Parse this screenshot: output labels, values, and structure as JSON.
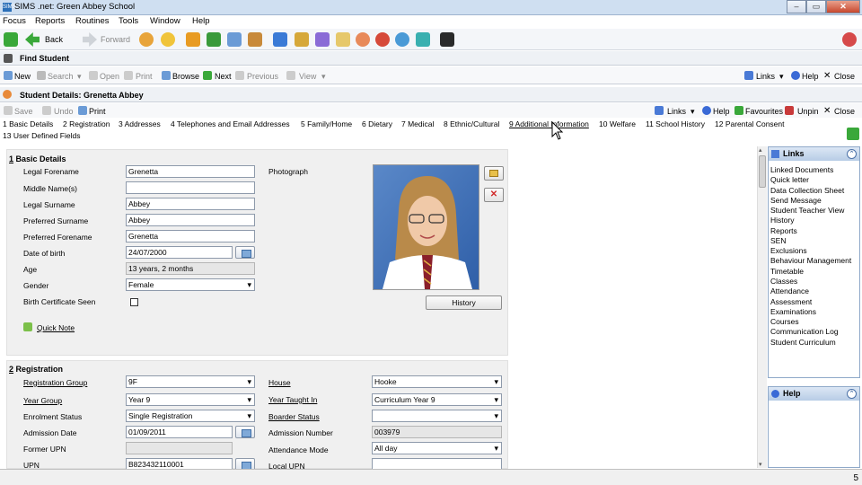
{
  "window": {
    "title": "SIMS .net: Green Abbey School",
    "logo_text": "SIMS"
  },
  "menu": [
    "Focus",
    "Reports",
    "Routines",
    "Tools",
    "Window",
    "Help"
  ],
  "nav": {
    "back": "Back",
    "forward": "Forward"
  },
  "find_student": {
    "title": "Find Student",
    "toolbar": {
      "new": "New",
      "search": "Search",
      "open": "Open",
      "print": "Print",
      "browse": "Browse",
      "next": "Next",
      "previous": "Previous",
      "view": "View",
      "links": "Links",
      "help": "Help",
      "close": "Close"
    }
  },
  "student_details": {
    "title": "Student Details: Grenetta Abbey",
    "toolbar": {
      "save": "Save",
      "undo": "Undo",
      "print": "Print",
      "links": "Links",
      "help": "Help",
      "favourites": "Favourites",
      "unpin": "Unpin",
      "close": "Close"
    },
    "tabs": [
      "1 Basic Details",
      "2 Registration",
      "3 Addresses",
      "4 Telephones and Email Addresses",
      "5 Family/Home",
      "6 Dietary",
      "7 Medical",
      "8 Ethnic/Cultural",
      "9 Additional Information",
      "10 Welfare",
      "11 School History",
      "12 Parental Consent",
      "13 User Defined Fields"
    ]
  },
  "basic_details": {
    "heading_num": "1",
    "heading": "Basic Details",
    "legal_forename_label": "Legal Forename",
    "legal_forename": "Grenetta",
    "middle_names_label": "Middle Name(s)",
    "middle_names": "",
    "legal_surname_label": "Legal Surname",
    "legal_surname": "Abbey",
    "preferred_surname_label": "Preferred Surname",
    "preferred_surname": "Abbey",
    "preferred_forename_label": "Preferred Forename",
    "preferred_forename": "Grenetta",
    "dob_label": "Date of birth",
    "dob": "24/07/2000",
    "age_label": "Age",
    "age": "13 years, 2 months",
    "gender_label": "Gender",
    "gender": "Female",
    "birth_cert_label": "Birth Certificate Seen",
    "quick_note": "Quick Note",
    "photograph_label": "Photograph",
    "history_button": "History"
  },
  "registration": {
    "heading_num": "2",
    "heading": "Registration",
    "reg_group_label": "Registration Group",
    "reg_group": "9F",
    "year_group_label": "Year Group",
    "year_group": "Year  9",
    "enrolment_label": "Enrolment Status",
    "enrolment": "Single Registration",
    "admission_date_label": "Admission Date",
    "admission_date": "01/09/2011",
    "former_upn_label": "Former UPN",
    "former_upn": "",
    "upn_label": "UPN",
    "upn": "B823432110001",
    "house_label": "House",
    "house": "Hooke",
    "year_taught_label": "Year Taught In",
    "year_taught": "Curriculum Year  9",
    "boarder_label": "Boarder Status",
    "boarder": "",
    "admission_number_label": "Admission Number",
    "admission_number": "003979",
    "attendance_mode_label": "Attendance Mode",
    "attendance_mode": "All day",
    "local_upn_label": "Local UPN",
    "local_upn": ""
  },
  "links_panel": {
    "title": "Links",
    "items": [
      "Linked Documents",
      "Quick letter",
      "Data Collection Sheet",
      "Send Message",
      "Student Teacher View",
      "History",
      "Reports",
      "SEN",
      "Exclusions",
      "Behaviour Management",
      "Timetable",
      "Classes",
      "Attendance",
      "Assessment",
      "Examinations",
      "Courses",
      "Communication Log",
      "Student Curriculum"
    ]
  },
  "help_panel": {
    "title": "Help"
  },
  "status": {
    "page_number": "5"
  }
}
